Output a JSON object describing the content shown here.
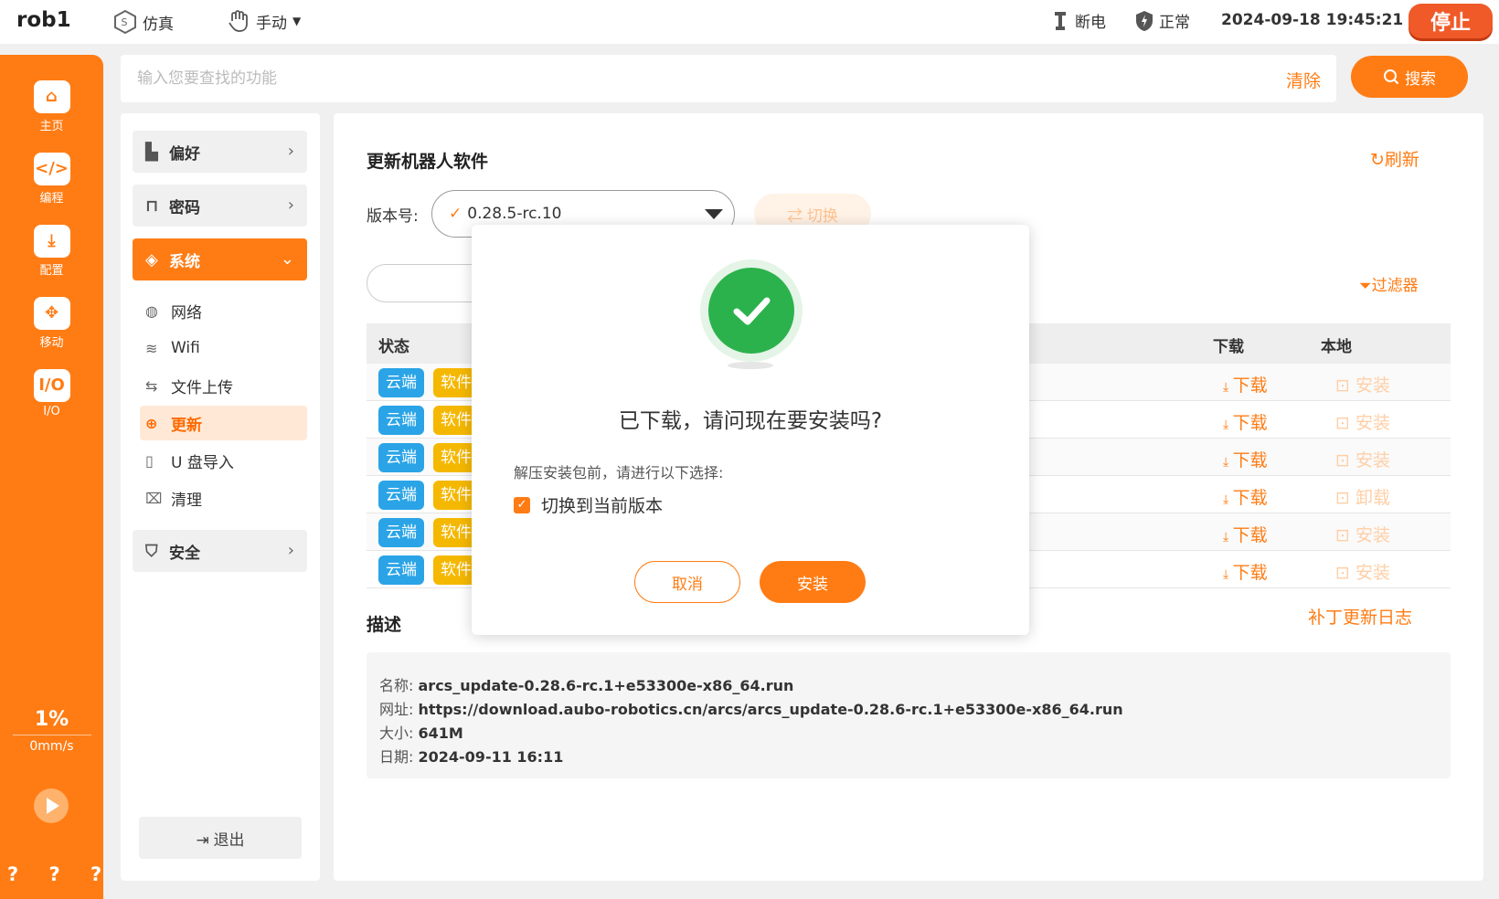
{
  "topbar": {
    "robot_name": "rob1",
    "sim_label": "仿真",
    "mode_label": "手动",
    "power_label": "断电",
    "state_label": "正常",
    "datetime": "2024-09-18 19:45:21",
    "stop_label": "停止"
  },
  "rail": {
    "items": [
      {
        "label": "主页",
        "icon": "home-icon"
      },
      {
        "label": "编程",
        "icon": "code-icon"
      },
      {
        "label": "配置",
        "icon": "download-config-icon"
      },
      {
        "label": "移动",
        "icon": "move-icon"
      },
      {
        "label": "I/O",
        "icon": "io-icon"
      }
    ],
    "speed_percent": "1%",
    "speed_value": "0mm/s",
    "footer": "? ? ? ?"
  },
  "search": {
    "placeholder": "输入您要查找的功能",
    "clear_label": "清除",
    "button_label": "搜索"
  },
  "nav": {
    "groups": [
      {
        "label": "偏好",
        "icon": "thumbs-up-icon"
      },
      {
        "label": "密码",
        "icon": "lock-icon"
      },
      {
        "label": "系统",
        "icon": "cube-icon"
      },
      {
        "label": "安全",
        "icon": "shield-icon"
      }
    ],
    "sub_items": [
      {
        "label": "网络",
        "icon": "globe-icon"
      },
      {
        "label": "Wifi",
        "icon": "wifi-icon"
      },
      {
        "label": "文件上传",
        "icon": "file-transfer-icon"
      },
      {
        "label": "更新",
        "icon": "upload-circle-icon"
      },
      {
        "label": "U 盘导入",
        "icon": "usb-icon"
      },
      {
        "label": "清理",
        "icon": "broom-icon"
      }
    ],
    "logout_label": "退出"
  },
  "main": {
    "title": "更新机器人软件",
    "refresh_label": "刷新",
    "version_label": "版本号:",
    "version_value": "0.28.5-rc.10",
    "switch_label": "切换",
    "filter_label": "过滤器",
    "columns": {
      "status": "状态",
      "download": "下载",
      "local": "本地"
    },
    "rows": [
      {
        "tag1": "云端",
        "tag2": "软件",
        "download": "下载",
        "local": "安装"
      },
      {
        "tag1": "云端",
        "tag2": "软件",
        "download": "下载",
        "local": "安装"
      },
      {
        "tag1": "云端",
        "tag2": "软件",
        "download": "下载",
        "local": "安装"
      },
      {
        "tag1": "云端",
        "tag2": "软件",
        "download": "下载",
        "local": "卸载"
      },
      {
        "tag1": "云端",
        "tag2": "软件",
        "download": "下载",
        "local": "安装"
      },
      {
        "tag1": "云端",
        "tag2": "软件",
        "download": "下载",
        "local": "安装"
      }
    ],
    "desc_title": "描述",
    "patch_log_label": "补丁更新日志",
    "desc": {
      "name_label": "名称:",
      "name": "arcs_update-0.28.6-rc.1+e53300e-x86_64.run",
      "url_label": "网址:",
      "url": "https://download.aubo-robotics.cn/arcs/arcs_update-0.28.6-rc.1+e53300e-x86_64.run",
      "size_label": "大小:",
      "size": "641M",
      "date_label": "日期:",
      "date": "2024-09-11 16:11"
    }
  },
  "modal": {
    "title": "已下载，请问现在要安装吗?",
    "hint": "解压安装包前，请进行以下选择:",
    "checkbox_label": "切换到当前版本",
    "checkbox_checked": true,
    "cancel_label": "取消",
    "install_label": "安装"
  },
  "colors": {
    "accent": "#ff7c14",
    "success": "#2bb24c",
    "cloud_tag": "#2aa4e6",
    "software_tag": "#f5b800"
  }
}
